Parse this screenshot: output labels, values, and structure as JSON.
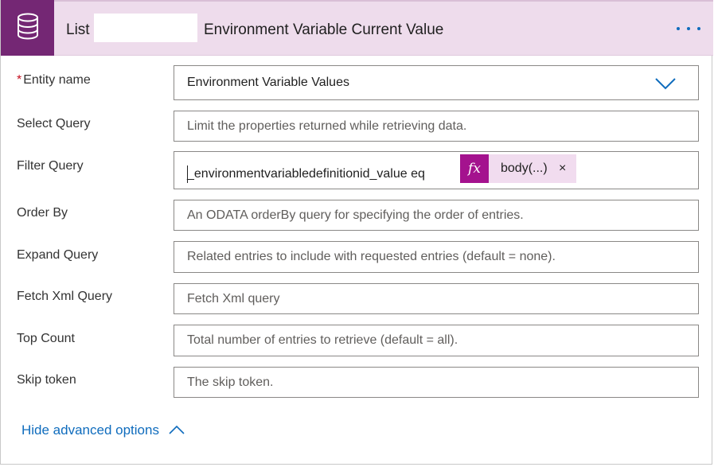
{
  "header": {
    "title_prefix": "List",
    "title_main": "Environment Variable Current Value",
    "icon": "database-icon",
    "more_icon": "more-horizontal-icon",
    "accent_color": "#742774",
    "header_bg": "#eedcec"
  },
  "fields": {
    "entity_name": {
      "label": "Entity name",
      "required_mark": "*",
      "value": "Environment Variable Values",
      "icon": "chevron-down-icon"
    },
    "select_query": {
      "label": "Select Query",
      "placeholder": "Limit the properties returned while retrieving data."
    },
    "filter_query": {
      "label": "Filter Query",
      "value": "_environmentvariabledefinitionid_value eq",
      "token": {
        "icon_text": "fx",
        "label": "body(...)",
        "remove": "×"
      }
    },
    "order_by": {
      "label": "Order By",
      "placeholder": "An ODATA orderBy query for specifying the order of entries."
    },
    "expand_query": {
      "label": "Expand Query",
      "placeholder": "Related entries to include with requested entries (default = none)."
    },
    "fetch_xml_query": {
      "label": "Fetch Xml Query",
      "placeholder": "Fetch Xml query"
    },
    "top_count": {
      "label": "Top Count",
      "placeholder": "Total number of entries to retrieve (default = all)."
    },
    "skip_token": {
      "label": "Skip token",
      "placeholder": "The skip token."
    }
  },
  "footer": {
    "toggle_label": "Hide advanced options",
    "toggle_icon": "chevron-up-icon",
    "link_color": "#0f6cbd"
  }
}
